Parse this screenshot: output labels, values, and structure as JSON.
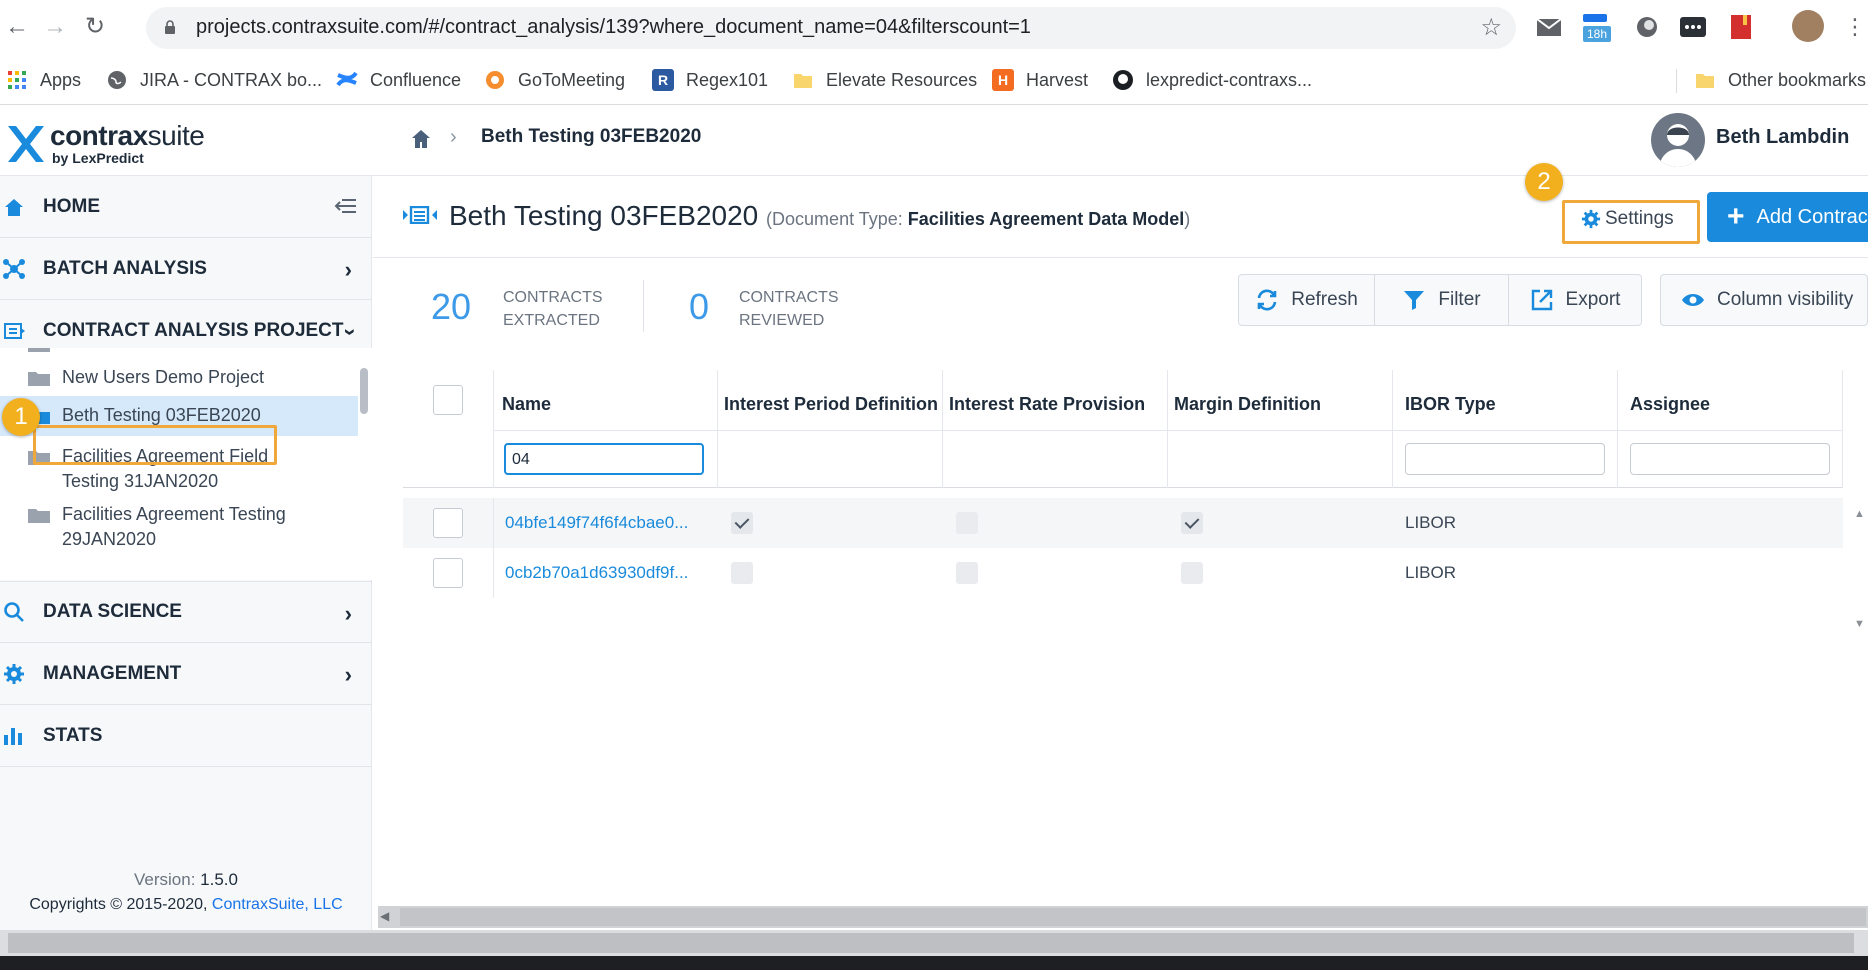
{
  "browser": {
    "url": "projects.contraxsuite.com/#/contract_analysis/139?where_document_name=04&filterscount=1",
    "calendar_badge": "18h",
    "bookmarks": [
      "Apps",
      "JIRA - CONTRAX bo...",
      "Confluence",
      "GoToMeeting",
      "Regex101",
      "Elevate Resources",
      "Harvest",
      "lexpredict-contraxs..."
    ],
    "other_bookmarks": "Other bookmarks"
  },
  "header": {
    "brand_bold": "contrax",
    "brand_light": "suite",
    "brand_by": "by LexPredict",
    "breadcrumb": "Beth Testing 03FEB2020",
    "user_name": "Beth Lambdin"
  },
  "sidebar": {
    "items": [
      "HOME",
      "BATCH ANALYSIS",
      "CONTRACT ANALYSIS PROJECT",
      "DATA SCIENCE",
      "MANAGEMENT",
      "STATS"
    ],
    "projects": [
      "New Users Demo Project",
      "Beth Testing 03FEB2020",
      "Facilities Agreement Field Testing 31JAN2020",
      "Facilities Agreement Testing 29JAN2020"
    ],
    "version_label": "Version:",
    "version": "1.5.0",
    "copyright": "Copyrights © 2015-2020,",
    "copyright_link": "ContraxSuite, LLC"
  },
  "callouts": {
    "one": "1",
    "two": "2"
  },
  "page": {
    "title": "Beth Testing 03FEB2020",
    "doc_type_label": "(Document Type:",
    "doc_type": "Facilities Agreement Data Model",
    "doc_type_close": ")",
    "settings": "Settings",
    "add_button": "Add Contract"
  },
  "stats": {
    "extracted_count": "20",
    "extracted_l1": "CONTRACTS",
    "extracted_l2": "EXTRACTED",
    "reviewed_count": "0",
    "reviewed_l1": "CONTRACTS",
    "reviewed_l2": "REVIEWED"
  },
  "toolbar": {
    "refresh": "Refresh",
    "filter": "Filter",
    "export": "Export",
    "column_visibility": "Column visibility"
  },
  "grid": {
    "columns": [
      "Name",
      "Interest Period Definition",
      "Interest Rate Provision",
      "Margin Definition",
      "IBOR Type",
      "Assignee"
    ],
    "name_filter": "04",
    "rows": [
      {
        "name": "04bfe149f74f6f4cbae0...",
        "interest_period": true,
        "interest_rate": false,
        "margin": true,
        "ibor": "LIBOR",
        "assignee": ""
      },
      {
        "name": "0cb2b70a1d63930df9f...",
        "interest_period": false,
        "interest_rate": false,
        "margin": false,
        "ibor": "LIBOR",
        "assignee": ""
      }
    ]
  },
  "colors": {
    "accent": "#1a8bdc",
    "callout": "#f2b01e",
    "selected_row": "#d6e9fb"
  }
}
